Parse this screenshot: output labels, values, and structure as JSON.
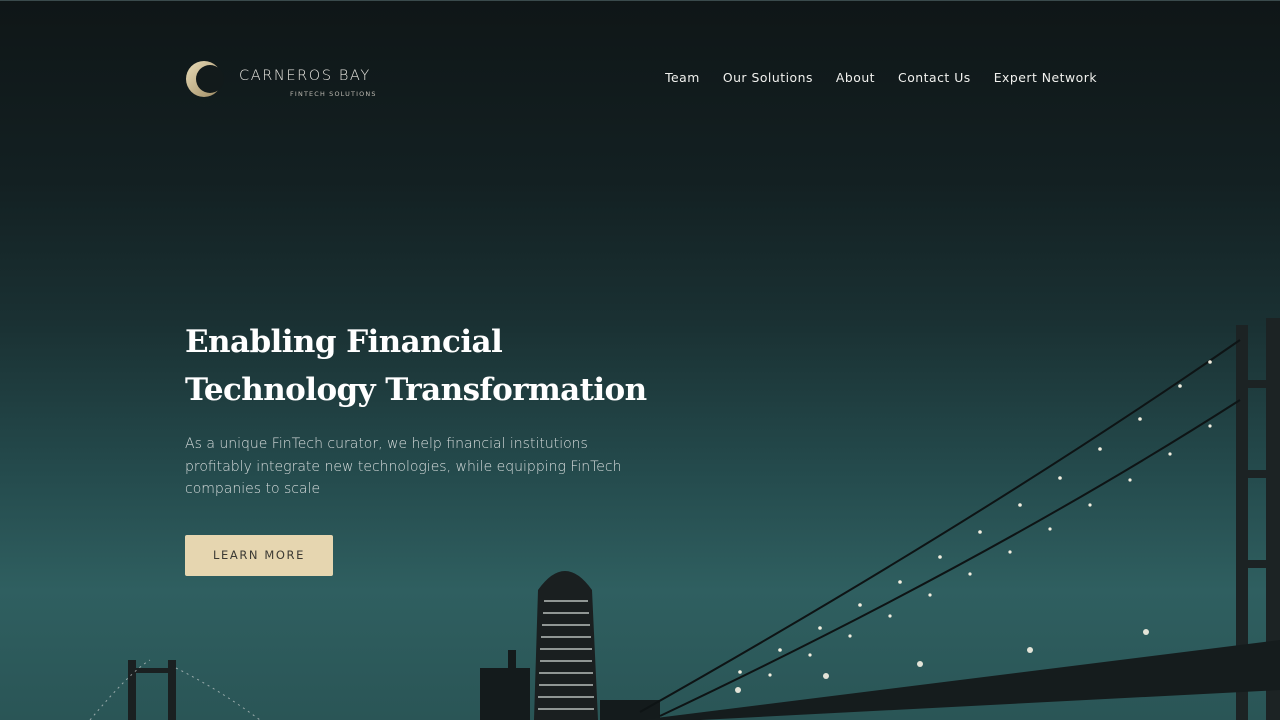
{
  "brand": {
    "name": "CARNEROS BAY",
    "tagline": "FINTECH SOLUTIONS"
  },
  "nav": {
    "items": [
      {
        "label": "Team"
      },
      {
        "label": "Our Solutions"
      },
      {
        "label": "About"
      },
      {
        "label": "Contact Us"
      },
      {
        "label": "Expert Network"
      }
    ]
  },
  "hero": {
    "title_line1": "Enabling Financial",
    "title_line2": "Technology Transformation",
    "description": "As a unique FinTech curator, we help financial institutions profitably integrate new technologies, while equipping FinTech companies to scale",
    "cta_label": "LEARN MORE"
  },
  "colors": {
    "cta_bg": "#e6d6b0",
    "logo_gold": "#c9b98f",
    "background_top": "#0f1617",
    "background_bottom": "#2f5f60"
  }
}
